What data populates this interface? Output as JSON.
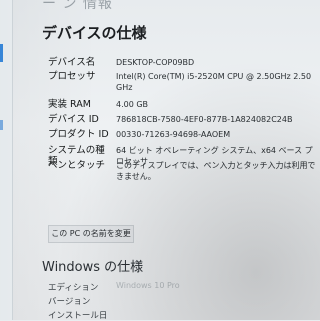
{
  "page": {
    "top_title_partial": "ー ン 情報",
    "heading": "デバイスの仕様"
  },
  "specs": [
    {
      "key": "デバイス名",
      "value": "DESKTOP-COP09BD"
    },
    {
      "key": "プロセッサ",
      "value": "Intel(R) Core(TM) i5-2520M CPU @ 2.50GHz 2.50 GHz"
    },
    {
      "key": "実装 RAM",
      "value": "4.00 GB"
    },
    {
      "key": "デバイス ID",
      "value": "786818CB-7580-4EF0-877B-1A824082C24B"
    },
    {
      "key": "プロダクト ID",
      "value": "00330-71263-94698-AAOEM"
    },
    {
      "key": "システムの種類",
      "value": "64 ビット オペレーティング システム、x64 ベース プロセッサ"
    },
    {
      "key": "ペンとタッチ",
      "value": "このディスプレイでは、ペン入力とタッチ入力は利用できません。"
    }
  ],
  "rename_button": "この PC の名前を変更",
  "windows_spec": {
    "heading": "Windows の仕様",
    "rows": [
      {
        "key": "エディション",
        "value": "Windows 10 Pro"
      },
      {
        "key": "バージョン",
        "value": ""
      },
      {
        "key": "インストール日",
        "value": ""
      }
    ]
  }
}
